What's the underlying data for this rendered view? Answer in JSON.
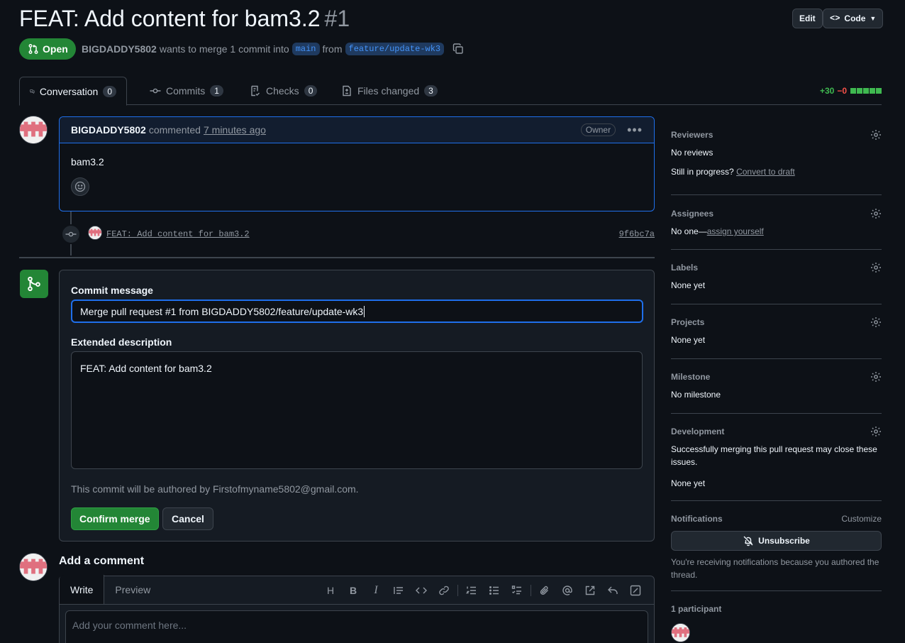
{
  "header": {
    "title": "FEAT: Add content for bam3.2",
    "number": "#1",
    "edit_label": "Edit",
    "code_label": "Code"
  },
  "state": {
    "label": "Open",
    "author": "BIGDADDY5802",
    "text_1": "wants to merge 1 commit into",
    "base_branch": "main",
    "text_2": "from",
    "head_branch": "feature/update-wk3"
  },
  "tabs": [
    {
      "label": "Conversation",
      "count": "0"
    },
    {
      "label": "Commits",
      "count": "1"
    },
    {
      "label": "Checks",
      "count": "0"
    },
    {
      "label": "Files changed",
      "count": "3"
    }
  ],
  "diffstat": {
    "additions": "+30",
    "deletions": "−0"
  },
  "comment": {
    "author": "BIGDADDY5802",
    "action": "commented",
    "time": "7 minutes ago",
    "badge": "Owner",
    "body": "bam3.2"
  },
  "commit_event": {
    "message": "FEAT: Add content for bam3.2",
    "sha": "9f6bc7a"
  },
  "merge": {
    "commit_message_label": "Commit message",
    "commit_message_value": "Merge pull request #1 from BIGDADDY5802/feature/update-wk3",
    "extended_label": "Extended description",
    "extended_value": "FEAT: Add content for bam3.2",
    "author_note": "This commit will be authored by Firstofmyname5802@gmail.com.",
    "confirm_label": "Confirm merge",
    "cancel_label": "Cancel"
  },
  "add_comment": {
    "title": "Add a comment",
    "write_tab": "Write",
    "preview_tab": "Preview",
    "placeholder": "Add your comment here..."
  },
  "sidebar": {
    "reviewers": {
      "title": "Reviewers",
      "value": "No reviews",
      "draft_text": "Still in progress?",
      "draft_link": "Convert to draft"
    },
    "assignees": {
      "title": "Assignees",
      "value": "No one—",
      "link": "assign yourself"
    },
    "labels": {
      "title": "Labels",
      "value": "None yet"
    },
    "projects": {
      "title": "Projects",
      "value": "None yet"
    },
    "milestone": {
      "title": "Milestone",
      "value": "No milestone"
    },
    "development": {
      "title": "Development",
      "desc": "Successfully merging this pull request may close these issues.",
      "value": "None yet"
    },
    "notifications": {
      "title": "Notifications",
      "customize": "Customize",
      "button": "Unsubscribe",
      "note": "You're receiving notifications because you authored the thread."
    },
    "participants": {
      "title": "1 participant"
    }
  },
  "colors": {
    "accent": "#1f6feb",
    "open_green": "#238636",
    "background": "#0d1117"
  }
}
